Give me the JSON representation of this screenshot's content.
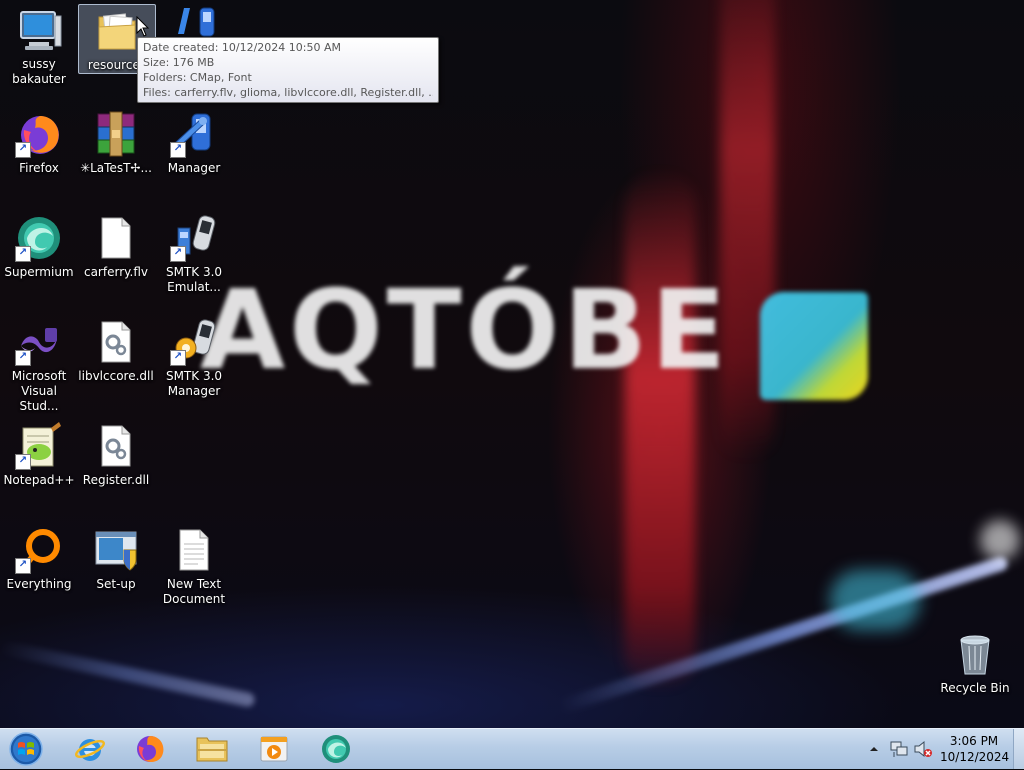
{
  "desktop": {
    "wallpaper_text": "AQTÓBE",
    "icons": [
      {
        "label": "sussy bakauter"
      },
      {
        "label": "resources"
      },
      {
        "label": ""
      },
      {
        "label": "Firefox"
      },
      {
        "label": "✳LaTesT✢..."
      },
      {
        "label": "Manager"
      },
      {
        "label": "Supermium"
      },
      {
        "label": "carferry.flv"
      },
      {
        "label": "SMTK 3.0 Emulat..."
      },
      {
        "label": "Microsoft Visual Stud..."
      },
      {
        "label": "libvlccore.dll"
      },
      {
        "label": "SMTK 3.0 Manager"
      },
      {
        "label": "Notepad++"
      },
      {
        "label": "Register.dll"
      },
      {
        "label": "Everything"
      },
      {
        "label": "Set-up"
      },
      {
        "label": "New Text Document"
      },
      {
        "label": "Recycle Bin"
      }
    ]
  },
  "tooltip": {
    "date_created": "Date created: 10/12/2024 10:50 AM",
    "size": "Size: 176 MB",
    "folders": "Folders: CMap, Font",
    "files": "Files: carferry.flv, glioma, libvlccore.dll, Register.dll, ..."
  },
  "taskbar": {
    "pinned": [
      "start-orb",
      "internet-explorer-icon",
      "firefox-icon",
      "file-explorer-icon",
      "media-player-icon",
      "supermium-icon"
    ],
    "clock": {
      "time": "3:06 PM",
      "date": "10/12/2024"
    }
  },
  "colors": {
    "taskbar": "#b7cde6",
    "tooltip_border": "#767676",
    "selection": "#b4c8e6"
  }
}
